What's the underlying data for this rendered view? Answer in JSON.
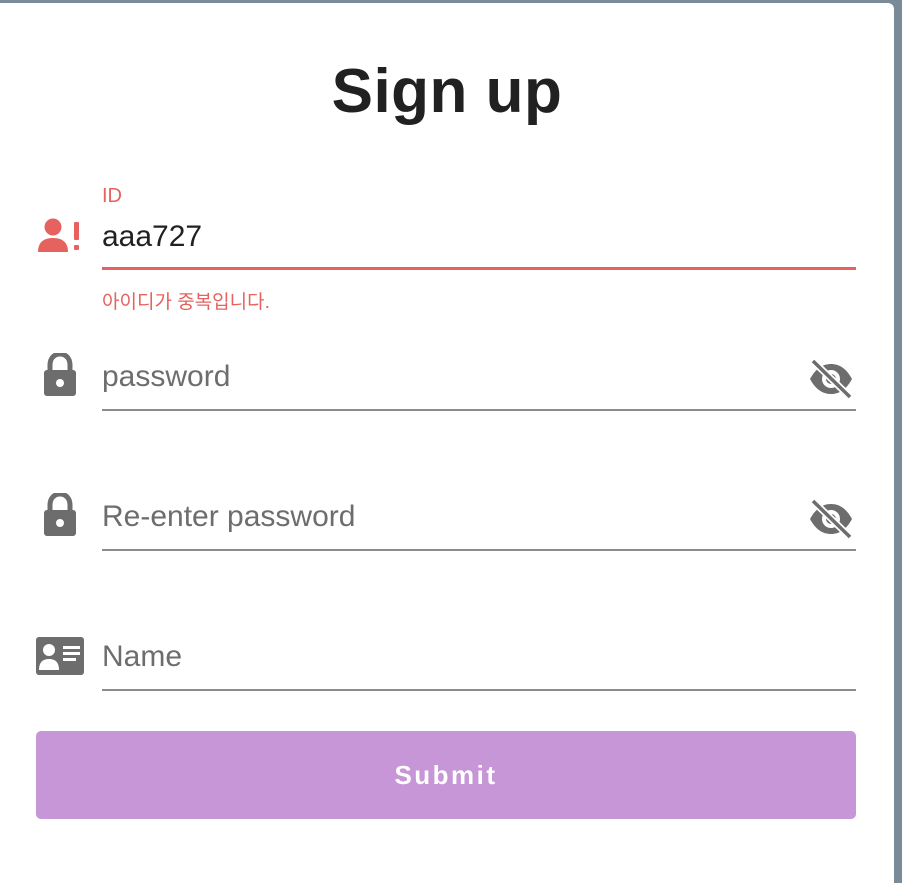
{
  "form": {
    "title": "Sign up",
    "id_field": {
      "label": "ID",
      "value": "aaa727",
      "error": "아이디가 중복입니다.",
      "icon": "person-alert-icon"
    },
    "password_field": {
      "placeholder": "password",
      "icon": "lock-icon",
      "toggle_icon": "eye-off-icon"
    },
    "reenter_password_field": {
      "placeholder": "Re-enter password",
      "icon": "lock-icon",
      "toggle_icon": "eye-off-icon"
    },
    "name_field": {
      "placeholder": "Name",
      "icon": "id-card-icon"
    },
    "submit_label": "Submit"
  },
  "colors": {
    "error": "#e5625f",
    "submit_disabled": "#c696d6",
    "icon_gray": "#6d6d6d"
  }
}
